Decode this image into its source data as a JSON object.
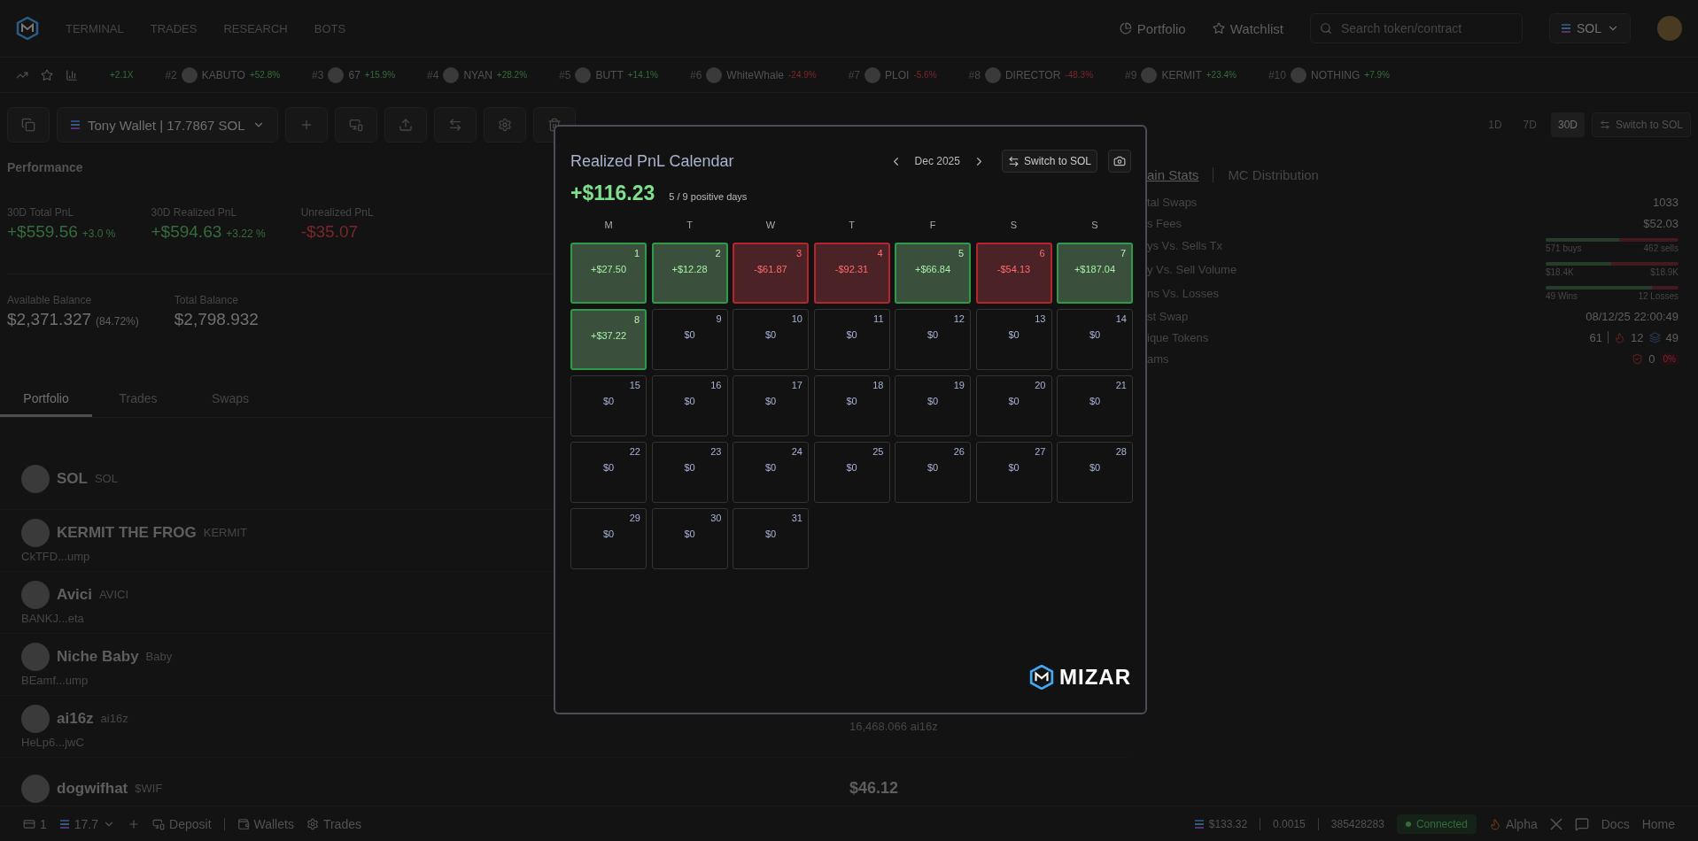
{
  "nav": {
    "links": [
      {
        "label": "TERMINAL"
      },
      {
        "label": "TRADES"
      },
      {
        "label": "RESEARCH"
      },
      {
        "label": "BOTS"
      }
    ],
    "portfolio": "Portfolio",
    "watchlist": "Watchlist",
    "search": {
      "placeholder": "Search token/contract"
    },
    "chain": "SOL"
  },
  "ticker": {
    "lead": "+2.1X",
    "items": [
      {
        "rank": "#2",
        "name": "KABUTO",
        "change": "+52.8%",
        "color": "#356c3c"
      },
      {
        "rank": "#3",
        "name": "67",
        "change": "+15.9%",
        "color": "#356c3c"
      },
      {
        "rank": "#4",
        "name": "NYAN",
        "change": "+28.2%",
        "color": "#356c3c"
      },
      {
        "rank": "#5",
        "name": "BUTT",
        "change": "+14.1%",
        "color": "#356c3c"
      },
      {
        "rank": "#6",
        "name": "WhiteWhale",
        "change": "-24.9%",
        "color": "#7b272c"
      },
      {
        "rank": "#7",
        "name": "PLOI",
        "change": "-5.6%",
        "color": "#7b272c"
      },
      {
        "rank": "#8",
        "name": "DIRECTOR",
        "change": "-48.3%",
        "color": "#7b272c"
      },
      {
        "rank": "#9",
        "name": "KERMIT",
        "change": "+23.4%",
        "color": "#356c3c"
      },
      {
        "rank": "#10",
        "name": "NOTHING",
        "change": "+7.9%",
        "color": "#356c3c"
      }
    ]
  },
  "wallet": {
    "name": "Tony Wallet | 17.7867 SOL",
    "timeframes": [
      {
        "label": "1D",
        "selected": false
      },
      {
        "label": "7D",
        "selected": false
      },
      {
        "label": "30D",
        "selected": true
      }
    ],
    "switch": "Switch to SOL"
  },
  "performance": {
    "title": "Performance",
    "metrics": [
      {
        "label": "30D Total PnL",
        "value": "+$559.56",
        "change": "+3.0 %",
        "color": "#356c3c"
      },
      {
        "label": "30D Realized PnL",
        "value": "+$594.63",
        "change": "+3.22 %",
        "color": "#356c3c"
      },
      {
        "label": "Unrealized PnL",
        "value": "-$35.07",
        "color": "#7b272c"
      }
    ],
    "balances": [
      {
        "label": "Available Balance",
        "value": "$2,371.327",
        "note": "(84.72%)"
      },
      {
        "label": "Total Balance",
        "value": "$2,798.932"
      }
    ]
  },
  "tabs": [
    {
      "label": "Portfolio",
      "selected": true
    },
    {
      "label": "Trades",
      "selected": false
    },
    {
      "label": "Swaps",
      "selected": false
    }
  ],
  "holdings": [
    {
      "name": "SOL",
      "symbol": "SOL"
    },
    {
      "name": "KERMIT THE FROG",
      "symbol": "KERMIT",
      "address": "CkTFD...ump"
    },
    {
      "name": "Avici",
      "symbol": "AVICI",
      "address": "BANKJ...eta"
    },
    {
      "name": "Niche Baby",
      "symbol": "Baby",
      "address": "BEamf...ump"
    },
    {
      "name": "ai16z",
      "symbol": "ai16z",
      "address": "HeLp6...jwC",
      "amount": "16,468.066 ai16z"
    },
    {
      "name": "dogwifhat",
      "symbol": "$WIF",
      "value": "$46.12"
    }
  ],
  "stats": {
    "tabs": [
      {
        "label": "ain Stats",
        "selected": true
      },
      {
        "label": "MC Distribution",
        "selected": false
      }
    ],
    "rows": [
      {
        "kind": "text",
        "label": "tal Swaps",
        "value": "1033"
      },
      {
        "kind": "text",
        "label": "s Fees",
        "value": "$52.03"
      },
      {
        "kind": "bar",
        "label": "ys Vs. Sells Tx",
        "level": 0.553,
        "left": "571 buys",
        "right": "462 sells"
      },
      {
        "kind": "bar",
        "label": "y Vs. Sell Volume",
        "level": 0.493,
        "left": "$18.4K",
        "right": "$18.9K"
      },
      {
        "kind": "bar",
        "label": "ns Vs. Losses",
        "level": 0.8,
        "left": "49 Wins",
        "right": "12 Losses"
      },
      {
        "kind": "text",
        "label": "st Swap",
        "value": "08/12/25 22:00:49"
      },
      {
        "kind": "tokens",
        "label": "ique Tokens",
        "value": "61",
        "first": "12",
        "second": "49"
      },
      {
        "kind": "scams",
        "label": "ams",
        "value": "0",
        "badge": "0%"
      }
    ]
  },
  "modal": {
    "title": "Realized PnL Calendar",
    "month": "Dec 2025",
    "switch": "Switch to SOL",
    "total": "+$116.23",
    "summary": "5 / 9 positive days",
    "weekdays": [
      "M",
      "T",
      "W",
      "T",
      "F",
      "S",
      "S"
    ],
    "brand": "MIZAR",
    "days": [
      {
        "day": "1",
        "value": "+$27.50",
        "kind": "gain"
      },
      {
        "day": "2",
        "value": "+$12.28",
        "kind": "gain"
      },
      {
        "day": "3",
        "value": "-$61.87",
        "kind": "loss"
      },
      {
        "day": "4",
        "value": "-$92.31",
        "kind": "loss"
      },
      {
        "day": "5",
        "value": "+$66.84",
        "kind": "gain"
      },
      {
        "day": "6",
        "value": "-$54.13",
        "kind": "loss"
      },
      {
        "day": "7",
        "value": "+$187.04",
        "kind": "gain"
      },
      {
        "day": "8",
        "value": "+$37.22",
        "kind": "gain"
      },
      {
        "day": "9",
        "value": "$0",
        "kind": "flat"
      },
      {
        "day": "10",
        "value": "$0",
        "kind": "flat"
      },
      {
        "day": "11",
        "value": "$0",
        "kind": "flat"
      },
      {
        "day": "12",
        "value": "$0",
        "kind": "flat"
      },
      {
        "day": "13",
        "value": "$0",
        "kind": "flat"
      },
      {
        "day": "14",
        "value": "$0",
        "kind": "flat"
      },
      {
        "day": "15",
        "value": "$0",
        "kind": "flat"
      },
      {
        "day": "16",
        "value": "$0",
        "kind": "flat"
      },
      {
        "day": "17",
        "value": "$0",
        "kind": "flat"
      },
      {
        "day": "18",
        "value": "$0",
        "kind": "flat"
      },
      {
        "day": "19",
        "value": "$0",
        "kind": "flat"
      },
      {
        "day": "20",
        "value": "$0",
        "kind": "flat"
      },
      {
        "day": "21",
        "value": "$0",
        "kind": "flat"
      },
      {
        "day": "22",
        "value": "$0",
        "kind": "flat"
      },
      {
        "day": "23",
        "value": "$0",
        "kind": "flat"
      },
      {
        "day": "24",
        "value": "$0",
        "kind": "flat"
      },
      {
        "day": "25",
        "value": "$0",
        "kind": "flat"
      },
      {
        "day": "26",
        "value": "$0",
        "kind": "flat"
      },
      {
        "day": "27",
        "value": "$0",
        "kind": "flat"
      },
      {
        "day": "28",
        "value": "$0",
        "kind": "flat"
      },
      {
        "day": "29",
        "value": "$0",
        "kind": "flat"
      },
      {
        "day": "30",
        "value": "$0",
        "kind": "flat"
      },
      {
        "day": "31",
        "value": "$0",
        "kind": "flat"
      }
    ]
  },
  "footer": {
    "wallets_count": "1",
    "balance": "17.7",
    "deposit": "Deposit",
    "wallets": "Wallets",
    "trades": "Trades",
    "sol_price": "$133.32",
    "fee": "0.0015",
    "block": "385428283",
    "status": "Connected",
    "connected": true,
    "alpha": "Alpha",
    "links": [
      "Docs",
      "Home"
    ]
  }
}
